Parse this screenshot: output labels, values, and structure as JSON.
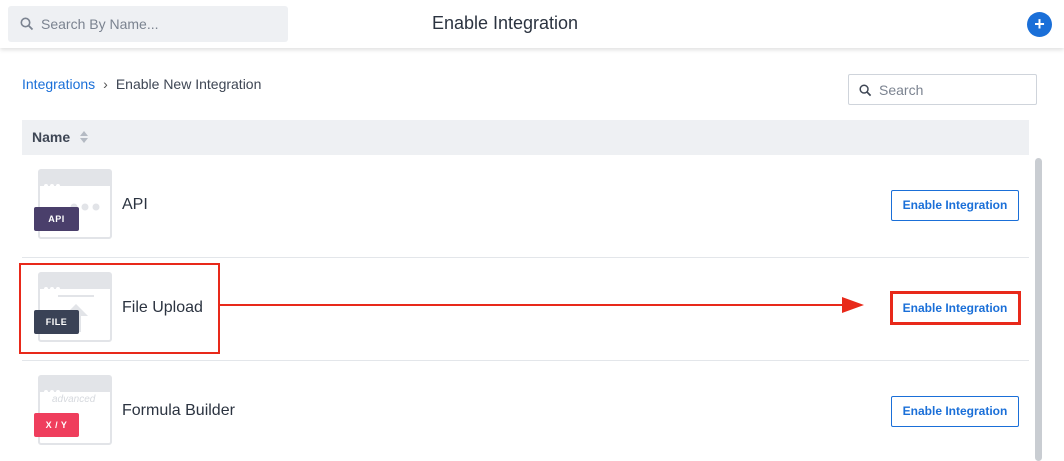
{
  "topbar": {
    "search_placeholder": "Search By Name...",
    "title": "Enable Integration",
    "add_label": "+"
  },
  "breadcrumb": {
    "root": "Integrations",
    "separator": "›",
    "current": "Enable New Integration"
  },
  "table_search": {
    "placeholder": "Search"
  },
  "table": {
    "column_name": "Name",
    "rows": [
      {
        "name": "API",
        "tag": "API",
        "button": "Enable Integration"
      },
      {
        "name": "File Upload",
        "tag": "FILE",
        "button": "Enable Integration"
      },
      {
        "name": "Formula Builder",
        "tag": "X / Y",
        "thumb_text": "advanced",
        "button": "Enable Integration"
      }
    ]
  },
  "colors": {
    "accent": "#1a6fd8",
    "annotation": "#e8291a",
    "tag_api": "#4a3f6b",
    "tag_file": "#3a4256",
    "tag_xy": "#ef3e5d"
  }
}
